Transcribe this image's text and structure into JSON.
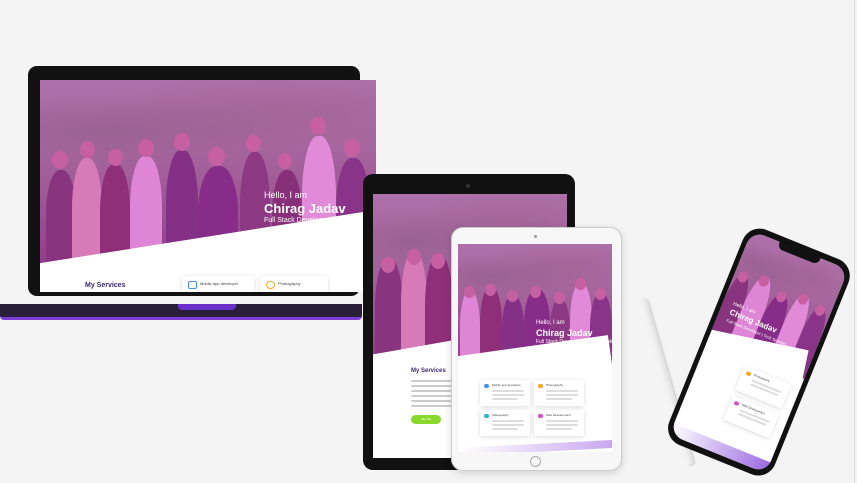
{
  "hero": {
    "greeting": "Hello, I am",
    "name": "Chirag Jadav",
    "role": "Full Stack Developer | Tech Speaker",
    "role_short": "Full Stack Developer | Tech Speake"
  },
  "services": {
    "title": "My Services",
    "cards": [
      {
        "label": "Mobile app developer",
        "icon": "mobile-icon",
        "color": "#4a90e2"
      },
      {
        "label": "Photography",
        "icon": "camera-icon",
        "color": "#f5a623"
      },
      {
        "label": "Videography",
        "icon": "video-icon",
        "color": "#2db5c9"
      },
      {
        "label": "Web Development",
        "icon": "web-icon",
        "color": "#d84fc9"
      }
    ],
    "button_label": "Hire Me"
  },
  "colors": {
    "tint": "#d63dc4",
    "accent": "#7b3fd6",
    "button": "#8bd82c",
    "heading": "#3a2a6a"
  }
}
